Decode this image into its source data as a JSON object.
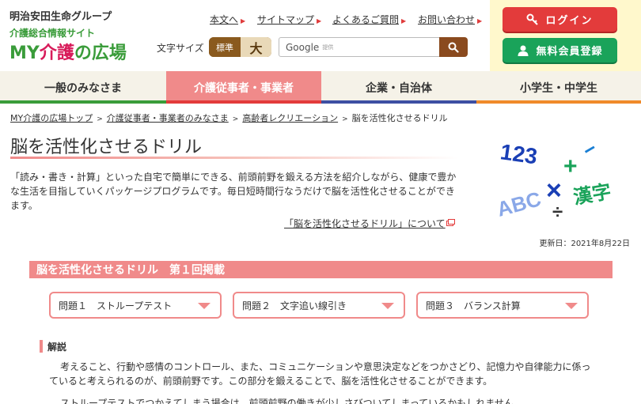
{
  "logo": {
    "group": "明治安田生命グループ",
    "subtitle": "介護総合情報サイト",
    "name_prefix": "MY",
    "name_main": "介護",
    "name_suffix": "の広場"
  },
  "util_nav": [
    {
      "label": "本文へ"
    },
    {
      "label": "サイトマップ"
    },
    {
      "label": "よくあるご質問"
    },
    {
      "label": "お問い合わせ"
    }
  ],
  "font_size": {
    "label": "文字サイズ",
    "standard": "標準",
    "large": "大"
  },
  "search": {
    "brand": "Google",
    "provided": "提供"
  },
  "auth": {
    "login": "ログイン",
    "signup": "無料会員登録"
  },
  "main_nav": [
    {
      "label": "一般のみなさま",
      "bar_color": "#3a9c3a"
    },
    {
      "label": "介護従事者・事業者",
      "bar_color": "#e33b3b",
      "active": true
    },
    {
      "label": "企業・自治体",
      "bar_color": "#3d4fa3"
    },
    {
      "label": "小学生・中学生",
      "bar_color": "#f08a2a"
    }
  ],
  "breadcrumb": [
    "MY介護の広場トップ",
    "介護従事者・事業者のみなさま",
    "高齢者レクリエーション",
    "脳を活性化させるドリル"
  ],
  "page": {
    "title": "脳を活性化させるドリル",
    "intro": "「読み・書き・計算」といった自宅で簡単にできる、前頭前野を鍛える方法を紹介しながら、健康で豊かな生活を目指していくパッケージプログラムです。毎日短時間行なうだけで脳を活性化させることができます。",
    "about_link": "「脳を活性化させるドリル」について",
    "updated": "更新日：2021年8月22日",
    "hero_text": {
      "numbers": "123",
      "letters": "ABC",
      "kanji": "漢字"
    }
  },
  "section": {
    "banner": "脳を活性化させるドリル　第１回掲載",
    "questions": [
      {
        "label": "問題１　ストループテスト"
      },
      {
        "label": "問題２　文字追い線引き"
      },
      {
        "label": "問題３　バランス計算"
      }
    ],
    "sub_heading": "解説",
    "body1": "考えること、行動や感情のコントロール、また、コミュニケーションや意思決定などをつかさどり、記憶力や自律能力に係っていると考えられるのが、前頭前野です。この部分を鍛えることで、脳を活性化させることができます。",
    "body2": "ストループテストでつかえてしまう場合は、前頭前野の働きが少しさびついてしまっているかもしれません"
  },
  "colors": {
    "accent_pink": "#f08a8a",
    "brand_green": "#3a9c3a",
    "login_red": "#e33b3b",
    "signup_green": "#1aa35a"
  }
}
